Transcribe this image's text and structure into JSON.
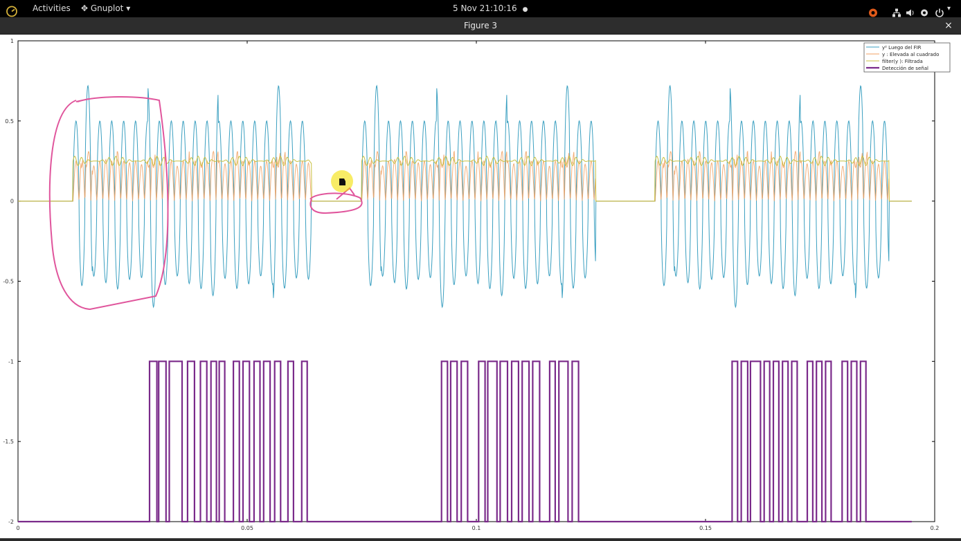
{
  "topbar": {
    "activities": "Activities",
    "app_menu": "Gnuplot",
    "clock": "5 Nov  21:10:16"
  },
  "window": {
    "title": "Figure 3",
    "close_glyph": "×"
  },
  "colors": {
    "series_fir": "#3a9fc0",
    "series_squared": "#f0a060",
    "series_filtered": "#c8c040",
    "series_detection": "#7a2a8a",
    "annotation": "#e0559c",
    "cursor_highlight": "#f4e000"
  },
  "chart_data": {
    "type": "line",
    "xlim": [
      0,
      0.2
    ],
    "ylim": [
      -2,
      1
    ],
    "x_ticks": [
      "0",
      "0.05",
      "0.1",
      "0.15",
      "0.2"
    ],
    "y_ticks": [
      "1",
      "0.5",
      "0",
      "-0.5",
      "-1",
      "-1.5",
      "-2"
    ],
    "grid": false,
    "legend_position": "top-right",
    "legend": [
      "y² Luego del FIR",
      "y : Elevada al cuadrado",
      "filter(y ): Filtrada",
      "Detección de señal"
    ],
    "bursts": [
      {
        "x_start": 0.012,
        "x_end": 0.064
      },
      {
        "x_start": 0.075,
        "x_end": 0.126
      },
      {
        "x_start": 0.139,
        "x_end": 0.19
      }
    ],
    "signal_envelope": {
      "peak": 0.5,
      "trough": -0.55,
      "max_peak": 0.72,
      "min_trough": -0.67,
      "squared_baseline": 0.25
    },
    "detection_pulses": [
      {
        "start": 0.0287,
        "end": 0.0303
      },
      {
        "start": 0.0307,
        "end": 0.0323
      },
      {
        "start": 0.033,
        "end": 0.0358
      },
      {
        "start": 0.037,
        "end": 0.0385
      },
      {
        "start": 0.0398,
        "end": 0.0412
      },
      {
        "start": 0.0421,
        "end": 0.0433
      },
      {
        "start": 0.0439,
        "end": 0.0451
      },
      {
        "start": 0.047,
        "end": 0.0483
      },
      {
        "start": 0.0491,
        "end": 0.0505
      },
      {
        "start": 0.0515,
        "end": 0.0528
      },
      {
        "start": 0.0536,
        "end": 0.055
      },
      {
        "start": 0.056,
        "end": 0.0573
      },
      {
        "start": 0.0589,
        "end": 0.0601
      },
      {
        "start": 0.0619,
        "end": 0.0631
      },
      {
        "start": 0.0924,
        "end": 0.0937
      },
      {
        "start": 0.0944,
        "end": 0.0958
      },
      {
        "start": 0.0967,
        "end": 0.0981
      },
      {
        "start": 0.1005,
        "end": 0.1019
      },
      {
        "start": 0.1025,
        "end": 0.1045
      },
      {
        "start": 0.1052,
        "end": 0.1068
      },
      {
        "start": 0.1077,
        "end": 0.1092
      },
      {
        "start": 0.11,
        "end": 0.1115
      },
      {
        "start": 0.1123,
        "end": 0.1138
      },
      {
        "start": 0.116,
        "end": 0.1172
      },
      {
        "start": 0.118,
        "end": 0.12
      },
      {
        "start": 0.1209,
        "end": 0.1223
      },
      {
        "start": 0.1558,
        "end": 0.157
      },
      {
        "start": 0.1578,
        "end": 0.1592
      },
      {
        "start": 0.1598,
        "end": 0.162
      },
      {
        "start": 0.1628,
        "end": 0.164
      },
      {
        "start": 0.1648,
        "end": 0.166
      },
      {
        "start": 0.1668,
        "end": 0.168
      },
      {
        "start": 0.1688,
        "end": 0.17
      },
      {
        "start": 0.1722,
        "end": 0.1734
      },
      {
        "start": 0.1742,
        "end": 0.1754
      },
      {
        "start": 0.1762,
        "end": 0.1774
      },
      {
        "start": 0.1798,
        "end": 0.181
      },
      {
        "start": 0.1818,
        "end": 0.183
      },
      {
        "start": 0.1838,
        "end": 0.185
      }
    ]
  }
}
